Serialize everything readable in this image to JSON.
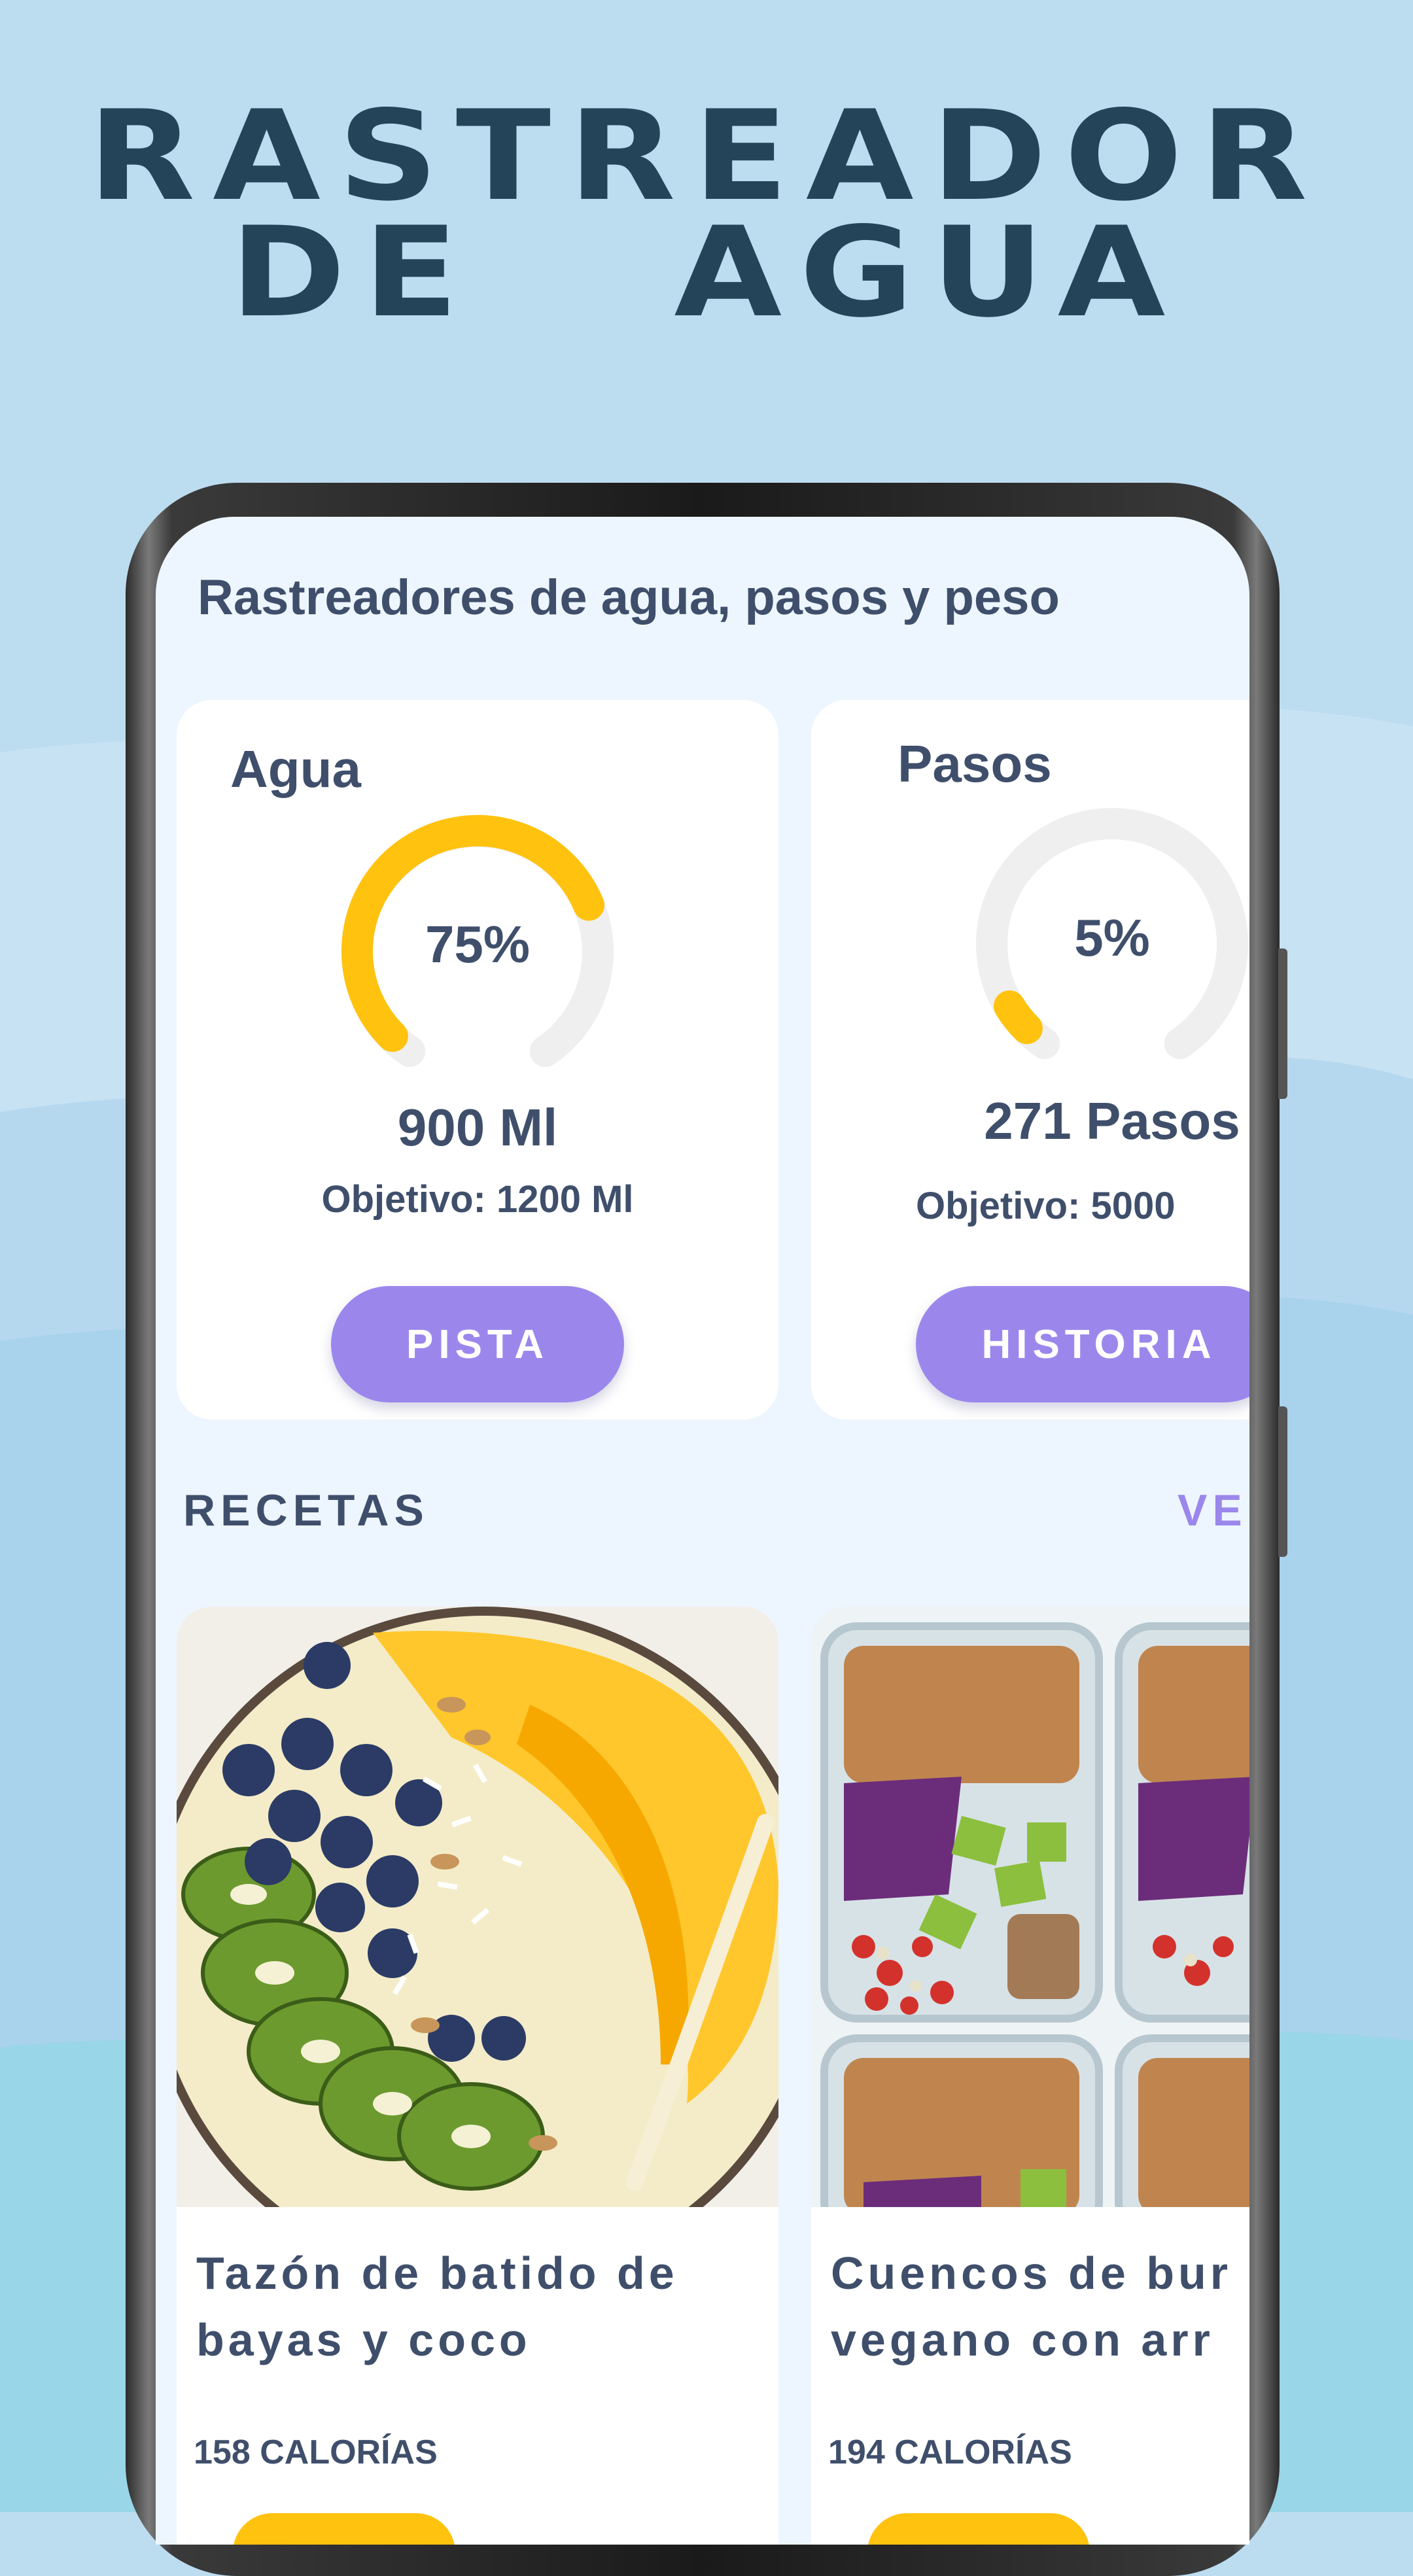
{
  "headline": {
    "line1": "RASTREADOR",
    "line2": "DE   AGUA"
  },
  "screen": {
    "title": "Rastreadores de agua, pasos y peso"
  },
  "trackers": [
    {
      "title": "Agua",
      "percent_label": "75%",
      "progress": 0.75,
      "value": "900 Ml",
      "goal": "Objetivo: 1200 Ml",
      "button_label": "PISTA",
      "color": "#ffc20e"
    },
    {
      "title": "Pasos",
      "percent_label": "5%",
      "progress": 0.05,
      "value": "271 Pasos",
      "goal": "Objetivo: 5000",
      "button_label": "HISTORIA",
      "color": "#ffc20e"
    }
  ],
  "recipes": {
    "section_title": "RECETAS",
    "see_all_label": "VE",
    "items": [
      {
        "name": "Tazón de batido de\nbayas y coco",
        "calories": "158 CALORÍAS",
        "image_icon": "smoothie-bowl-photo"
      },
      {
        "name": "Cuencos de bur\nvegano con arr",
        "calories": "194 CALORÍAS",
        "image_icon": "meal-prep-containers-photo"
      }
    ]
  },
  "colors": {
    "background": "#bcdcf0",
    "headline": "#244559",
    "accent_purple": "#9b87ec",
    "accent_yellow": "#ffc20e",
    "text": "#3f4f6b",
    "screen_bg": "#edf6fe"
  }
}
